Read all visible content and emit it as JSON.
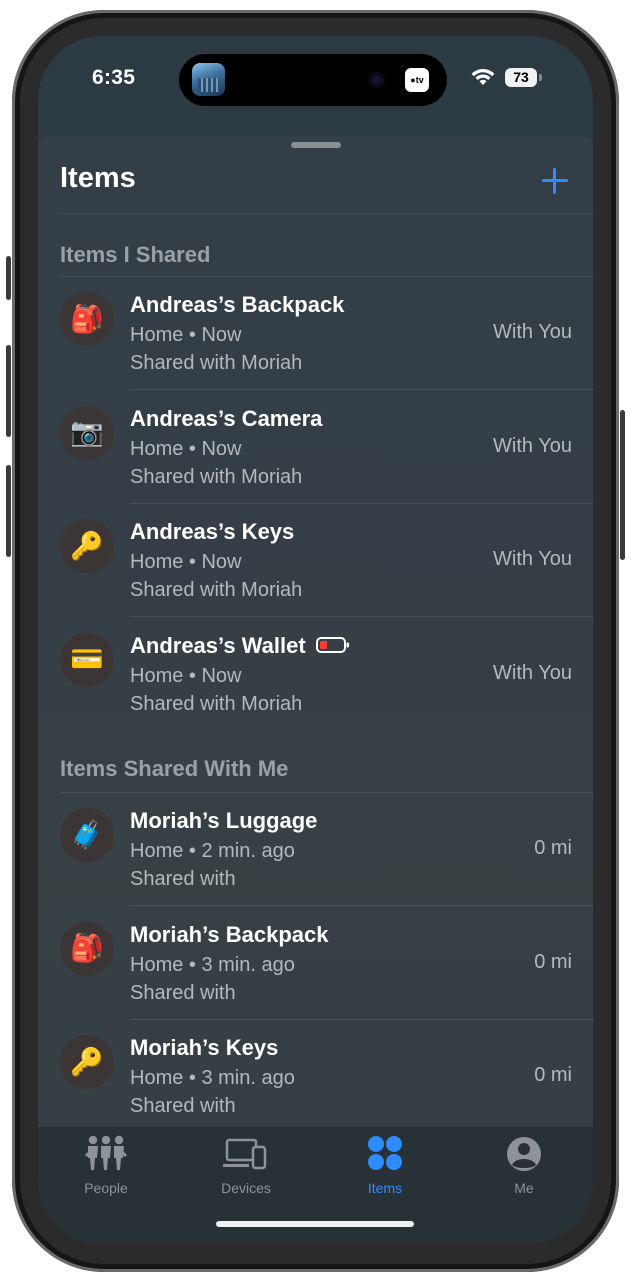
{
  "status_bar": {
    "time": "6:35",
    "tv_badge": "●tv",
    "battery_level": "73"
  },
  "header": {
    "title": "Items",
    "add_icon": "plus-icon"
  },
  "sections": {
    "shared": {
      "title": "Items I Shared"
    },
    "shared_with_me": {
      "title": "Items Shared With Me"
    }
  },
  "items_shared": [
    {
      "icon": "red-backpack-icon",
      "emoji": "🎒",
      "name": "Andreas’s Backpack",
      "location": "Home • Now",
      "shared_text": "Shared with Moriah",
      "status": "With You"
    },
    {
      "icon": "camera-icon",
      "emoji": "📷",
      "name": "Andreas’s Camera",
      "location": "Home • Now",
      "shared_text": "Shared with Moriah",
      "status": "With You"
    },
    {
      "icon": "key-icon",
      "emoji": "🔑",
      "name": "Andreas’s Keys",
      "location": "Home • Now",
      "shared_text": "Shared with Moriah",
      "status": "With You"
    },
    {
      "icon": "wallet-card-icon",
      "emoji": "💳",
      "name": "Andreas’s Wallet",
      "location": "Home • Now",
      "shared_text": "Shared with Moriah",
      "status": "With You",
      "low_battery": true
    }
  ],
  "items_shared_with_me": [
    {
      "icon": "luggage-icon",
      "emoji": "🧳",
      "name": "Moriah’s Luggage",
      "location": "Home • 2 min. ago",
      "shared_text": "Shared with",
      "status": "0 mi"
    },
    {
      "icon": "red-backpack-icon",
      "emoji": "🎒",
      "name": "Moriah’s Backpack",
      "location": "Home • 3 min. ago",
      "shared_text": "Shared with",
      "status": "0 mi"
    },
    {
      "icon": "key-icon",
      "emoji": "🔑",
      "name": "Moriah’s Keys",
      "location": "Home • 3 min. ago",
      "shared_text": "Shared with",
      "status": "0 mi"
    }
  ],
  "tabs": [
    {
      "label": "People",
      "icon": "people-icon"
    },
    {
      "label": "Devices",
      "icon": "devices-icon"
    },
    {
      "label": "Items",
      "icon": "items-grid-icon",
      "active": true
    },
    {
      "label": "Me",
      "icon": "person-circle-icon"
    }
  ],
  "colors": {
    "accent": "#2f8cff",
    "low_battery": "#ff3b30"
  }
}
